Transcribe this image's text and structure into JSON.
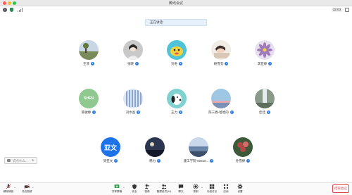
{
  "window": {
    "title": "腾讯会议"
  },
  "info": {
    "timer": "32:03"
  },
  "banner": {
    "speaking_label": "正在讲话:"
  },
  "participants": [
    {
      "name": "王菲",
      "avatar": "photo-landscape",
      "color": "#7a8a5a"
    },
    {
      "name": "张晓",
      "avatar": "photo-person",
      "color": "#c9c9c9"
    },
    {
      "name": "刘冬",
      "avatar": "photo-cartoon",
      "color": "#4fc4d8"
    },
    {
      "name": "杨雪莹",
      "avatar": "photo-sleeping",
      "color": "#d9c7b8"
    },
    {
      "name": "李亚婷",
      "avatar": "photo-flower",
      "color": "#9f7ab8"
    },
    {
      "name": "陈敏婷",
      "avatar": "text-shen",
      "avatar_text": "SHEN",
      "color": "#8fc98f"
    },
    {
      "name": "刘水晶",
      "avatar": "photo-glass",
      "color": "#8aa6d0"
    },
    {
      "name": "王力",
      "avatar": "photo-snoopy",
      "color": "#7fd2d0"
    },
    {
      "name": "陈三春-哈哈的",
      "avatar": "photo-sky",
      "color": "#9ec7e6"
    },
    {
      "name": "佳佳",
      "avatar": "photo-waterfall",
      "color": "#8a9a8a"
    },
    {
      "name": "梁亚文",
      "avatar": "text-yawen",
      "avatar_text": "亚文",
      "color": "#1e73e8"
    },
    {
      "name": "韩力",
      "avatar": "photo-night",
      "color": "#2c3550"
    },
    {
      "name": "建工学院-00315...",
      "avatar": "photo-coast",
      "color": "#6a84a8"
    },
    {
      "name": "孙雪婷",
      "avatar": "photo-roses",
      "color": "#b04848"
    }
  ],
  "chat": {
    "placeholder": "说点什么...",
    "send_icon": "send-icon"
  },
  "toolbar": {
    "mute": "解除静音",
    "video": "开启视频",
    "share": "共享屏幕",
    "safety": "安全",
    "invite": "邀请",
    "members": "管理成员(14)",
    "chat": "聊天",
    "record": "录制",
    "breakout": "分组讨论",
    "apps": "应用",
    "settings": "设置",
    "end": "结束会议"
  },
  "colors": {
    "accent": "#2a7be4",
    "end": "#e24a4a",
    "share": "#2fa24a"
  }
}
